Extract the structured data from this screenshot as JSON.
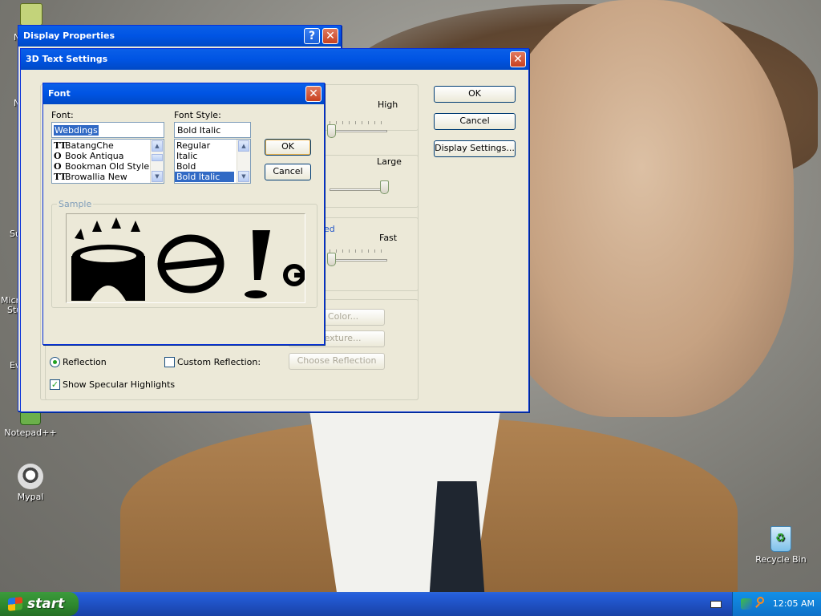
{
  "desktop": {
    "icons": [
      {
        "id": "notepad",
        "label": "Notepad++",
        "color": "#6bb04a"
      },
      {
        "id": "mypal",
        "label": "Mypal",
        "color": "#d9d9d9"
      },
      {
        "id": "recycle",
        "label": "Recycle Bin",
        "color": "#5fb3e6"
      }
    ],
    "edge_labels": [
      "N",
      "Su",
      "Micro",
      "Stu",
      "Ev"
    ]
  },
  "display_properties": {
    "title": "Display Properties",
    "help_glyph": "?",
    "close_glyph": "✕"
  },
  "text3d": {
    "title": "3D Text Settings",
    "close_glyph": "✕",
    "ok_label": "OK",
    "cancel_label": "Cancel",
    "display_settings_label": "Display Settings...",
    "slider_labels": [
      "High",
      "Large",
      "Fast"
    ],
    "ed_fragment": "ed",
    "disabled_buttons": [
      "se Color...",
      "e Texture...",
      "Choose Reflection"
    ],
    "reflection_label": "Reflection",
    "custom_reflection_label": "Custom Reflection:",
    "specular_label": "Show Specular Highlights"
  },
  "font_dialog": {
    "title": "Font",
    "close_glyph": "✕",
    "font_label": "Font:",
    "font_value": "Webdings",
    "font_list": [
      {
        "icon": "TT",
        "name": "BatangChe"
      },
      {
        "icon": "O",
        "name": "Book Antiqua"
      },
      {
        "icon": "O",
        "name": "Bookman Old Style"
      },
      {
        "icon": "TT",
        "name": "Browallia New"
      }
    ],
    "style_label": "Font Style:",
    "style_value": "Bold Italic",
    "style_list": [
      "Regular",
      "Italic",
      "Bold",
      "Bold Italic"
    ],
    "selected_style": "Bold Italic",
    "ok_label": "OK",
    "cancel_label": "Cancel",
    "sample_label": "Sample"
  },
  "taskbar": {
    "start_label": "start",
    "clock": "12:05 AM"
  },
  "colors": {
    "title_blue": "#0054e3",
    "selection_blue": "#316ac5",
    "taskbar_blue": "#245edb",
    "start_green": "#2f8a2f"
  }
}
